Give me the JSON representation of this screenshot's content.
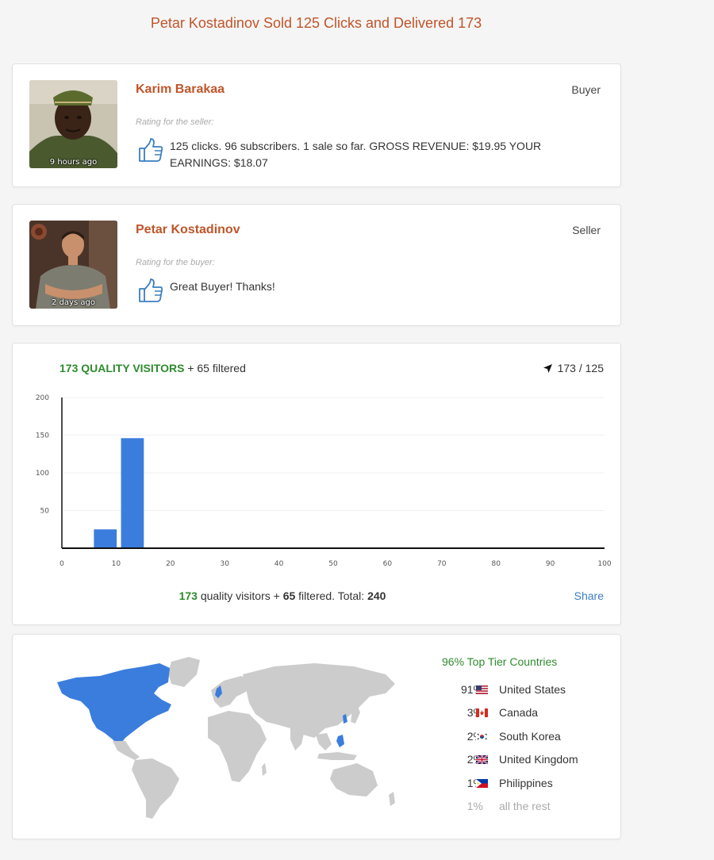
{
  "page": {
    "title": "Petar Kostadinov Sold 125 Clicks and Delivered 173"
  },
  "reviews": [
    {
      "name": "Karim Barakaa",
      "role": "Buyer",
      "time": "9 hours ago",
      "rating_label": "Rating for the seller:",
      "text": "125 clicks. 96 subscribers. 1 sale so far. GROSS REVENUE: $19.95 YOUR EARNINGS: $18.07",
      "icon": "thumbs-up-icon"
    },
    {
      "name": "Petar Kostadinov",
      "role": "Seller",
      "time": "2 days ago",
      "rating_label": "Rating for the buyer:",
      "text": "Great Buyer! Thanks!",
      "icon": "thumbs-up-icon"
    }
  ],
  "stats": {
    "quality_count": "173 QUALITY VISITORS",
    "filtered": "+ 65 filtered",
    "ratio": "173 / 125",
    "totals": {
      "quality": "173",
      "quality_text": "quality visitors +",
      "filtered": "65",
      "filtered_text": "filtered. Total:",
      "total": "240"
    },
    "share_label": "Share"
  },
  "chart_data": {
    "type": "bar",
    "x_ticks": [
      "0",
      "10",
      "20",
      "30",
      "40",
      "50",
      "60",
      "70",
      "80",
      "90",
      "100"
    ],
    "y_ticks": [
      "50",
      "100",
      "150",
      "200"
    ],
    "xlim": [
      0,
      100
    ],
    "ylim": [
      0,
      200
    ],
    "bars": [
      {
        "x": 8,
        "value": 25
      },
      {
        "x": 13,
        "value": 146
      }
    ],
    "bar_color": "#3b7ddd"
  },
  "geo": {
    "tier_label": "96% Top Tier Countries",
    "countries": [
      {
        "pct": "91%",
        "name": "United States",
        "flag": "us-flag-icon"
      },
      {
        "pct": "3%",
        "name": "Canada",
        "flag": "canada-flag-icon"
      },
      {
        "pct": "2%",
        "name": "South Korea",
        "flag": "south-korea-flag-icon"
      },
      {
        "pct": "2%",
        "name": "United Kingdom",
        "flag": "uk-flag-icon"
      },
      {
        "pct": "1%",
        "name": "Philippines",
        "flag": "philippines-flag-icon"
      }
    ],
    "rest": {
      "pct": "1%",
      "name": "all the rest"
    },
    "highlight_color": "#3b7ddd",
    "land_color": "#cccccc"
  },
  "colors": {
    "accent": "#c0552a",
    "green": "#2e8b2e",
    "link": "#3a7ec2"
  }
}
